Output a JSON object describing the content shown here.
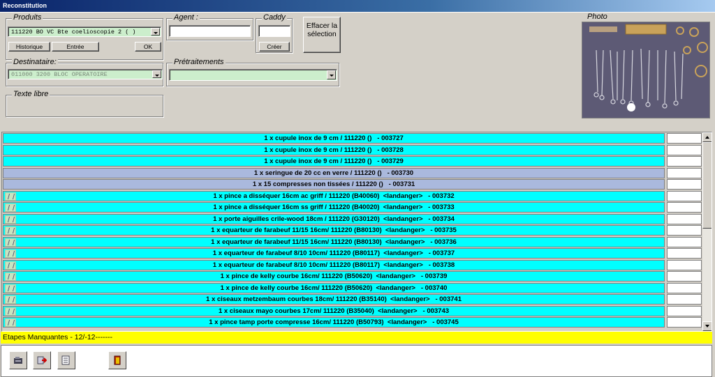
{
  "window": {
    "title": "Reconstitution"
  },
  "produits": {
    "legend": "Produits",
    "selected": "111220 BO VC  Bte coelioscopie 2  ( )",
    "buttons": {
      "historique": "Historique",
      "entree": "Entrée",
      "ok": "OK"
    }
  },
  "agent": {
    "legend": "Agent :",
    "value": ""
  },
  "caddy": {
    "legend": "Caddy",
    "value": "",
    "creer": "Créer"
  },
  "effacer": {
    "label": "Effacer la sélection"
  },
  "destinataire": {
    "legend": "Destinataire:",
    "selected": "011000 3200   BLOC OPERATOIRE"
  },
  "pretraitements": {
    "legend": "Prétraitements",
    "selected": ""
  },
  "texte_libre": {
    "legend": "Texte libre",
    "value": ""
  },
  "photo": {
    "legend": "Photo"
  },
  "list": {
    "rows": [
      {
        "text": "1 x cupule inox de 9 cm / 111220 ()   - 003727",
        "color": "cyan",
        "icon": false
      },
      {
        "text": "1 x cupule inox de 9 cm / 111220 ()   - 003728",
        "color": "cyan",
        "icon": false
      },
      {
        "text": "1 x cupule inox de 9 cm / 111220 ()   - 003729",
        "color": "cyan",
        "icon": false
      },
      {
        "text": "1 x seringue de 20 cc en verre / 111220 ()   - 003730",
        "color": "lavender",
        "icon": false
      },
      {
        "text": "1 x 15 compresses non tissées / 111220 ()   - 003731",
        "color": "lavender",
        "icon": false
      },
      {
        "text": "1 x pince a disséquer 16cm ac griff / 111220 (B40060)  <landanger>   - 003732",
        "color": "cyan",
        "icon": true
      },
      {
        "text": "1 x pince a disséquer 16cm ss griff / 111220 (B40020)  <landanger>   - 003733",
        "color": "cyan",
        "icon": true
      },
      {
        "text": "1 x porte aiguilles crile-wood 18cm / 111220 (G30120)  <landanger>   - 003734",
        "color": "cyan",
        "icon": true
      },
      {
        "text": "1 x equarteur de farabeuf 11/15 16cm/ 111220 (B80130)  <landanger>   - 003735",
        "color": "cyan",
        "icon": true
      },
      {
        "text": "1 x equarteur de farabeuf 11/15 16cm/ 111220 (B80130)  <landanger>   - 003736",
        "color": "cyan",
        "icon": true
      },
      {
        "text": "1 x equarteur de farabeuf 8/10 10cm/ 111220 (B80117)  <landanger>   - 003737",
        "color": "cyan",
        "icon": true
      },
      {
        "text": "1 x equarteur de farabeuf 8/10 10cm/ 111220 (B80117)  <landanger>   - 003738",
        "color": "cyan",
        "icon": true
      },
      {
        "text": "1 x pince de kelly courbe 16cm/ 111220 (B50620)  <landanger>   - 003739",
        "color": "cyan",
        "icon": true
      },
      {
        "text": "1 x pince de kelly courbe 16cm/ 111220 (B50620)  <landanger>   - 003740",
        "color": "cyan",
        "icon": true
      },
      {
        "text": "1 x ciseaux metzembaum courbes 18cm/ 111220 (B35140)  <landanger>   - 003741",
        "color": "cyan",
        "icon": true
      },
      {
        "text": "1 x ciseaux mayo courbes 17cm/ 111220 (B35040)  <landanger>   - 003743",
        "color": "cyan",
        "icon": true
      },
      {
        "text": "1 x pince tamp porte compresse 16cm/ 111220 (B50793)  <landanger>   - 003745",
        "color": "cyan",
        "icon": true
      }
    ]
  },
  "status": {
    "text": "Etapes Manquantes - 12/-12-------"
  },
  "colors": {
    "cyan": "#00ffff",
    "lavender": "#aab9dd",
    "status_bg": "#ffff00"
  },
  "toolbar": {
    "icons": [
      "scanner-icon",
      "export-icon",
      "list-icon",
      "exit-door-icon"
    ]
  }
}
